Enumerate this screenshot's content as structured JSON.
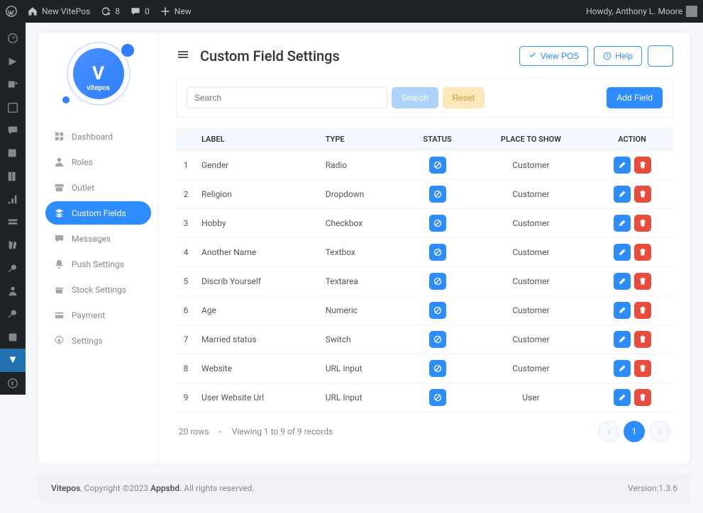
{
  "wp_bar": {
    "site_name": "New VitePos",
    "updates": "8",
    "comments": "0",
    "new": "New",
    "greeting": "Howdy, Anthony L. Moore"
  },
  "page": {
    "title": "Custom Field Settings"
  },
  "header_buttons": {
    "view_pos": "View POS",
    "help": "Help"
  },
  "sidebar": {
    "items": [
      {
        "label": "Dashboard",
        "icon": "gauge"
      },
      {
        "label": "Roles",
        "icon": "users"
      },
      {
        "label": "Outlet",
        "icon": "store"
      },
      {
        "label": "Custom Fields",
        "icon": "layers",
        "active": true
      },
      {
        "label": "Messages",
        "icon": "msg"
      },
      {
        "label": "Push Settings",
        "icon": "bell"
      },
      {
        "label": "Stock Settings",
        "icon": "box"
      },
      {
        "label": "Payment",
        "icon": "card"
      },
      {
        "label": "Settings",
        "icon": "gear"
      }
    ]
  },
  "toolbar": {
    "search_placeholder": "Search",
    "search_btn": "Search",
    "reset_btn": "Reset",
    "add_btn": "Add Field"
  },
  "table": {
    "headers": {
      "label": "LABEL",
      "type": "TYPE",
      "status": "STATUS",
      "place": "PLACE TO SHOW",
      "action": "ACTION"
    },
    "rows": [
      {
        "n": "1",
        "label": "Gender",
        "type": "Radio",
        "place": "Customer"
      },
      {
        "n": "2",
        "label": "Religion",
        "type": "Dropdown",
        "place": "Customer"
      },
      {
        "n": "3",
        "label": "Hobby",
        "type": "Checkbox",
        "place": "Customer"
      },
      {
        "n": "4",
        "label": "Another Name",
        "type": "Textbox",
        "place": "Customer"
      },
      {
        "n": "5",
        "label": "Discrib Yourself",
        "type": "Textarea",
        "place": "Customer"
      },
      {
        "n": "6",
        "label": "Age",
        "type": "Numeric",
        "place": "Customer"
      },
      {
        "n": "7",
        "label": "Married status",
        "type": "Switch",
        "place": "Customer"
      },
      {
        "n": "8",
        "label": "Website",
        "type": "URL Input",
        "place": "Customer"
      },
      {
        "n": "9",
        "label": "User Website Url",
        "type": "URL Input",
        "place": "User"
      }
    ]
  },
  "pagination": {
    "rows_label": "20 rows",
    "viewing": "Viewing 1 to 9 of 9 records",
    "current": "1"
  },
  "footer": {
    "brand": "Vitepos",
    "copyright": ", Copyright ©2023 ",
    "company": "Appsbd",
    "rights": ". All rights reserved.",
    "version": "Version:1.3.6"
  }
}
